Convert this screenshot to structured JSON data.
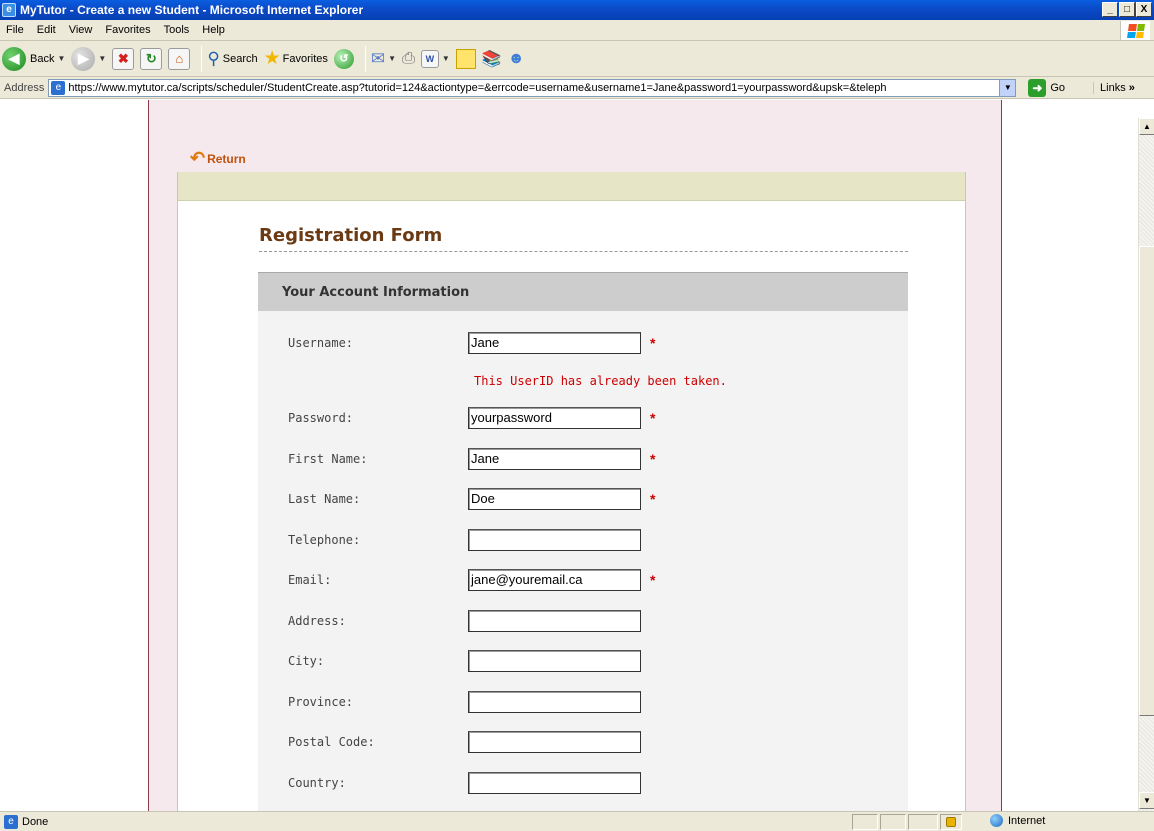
{
  "window": {
    "title": "MyTutor - Create a new Student - Microsoft Internet Explorer",
    "minimize": "_",
    "maximize": "□",
    "close": "X"
  },
  "menu": [
    "File",
    "Edit",
    "View",
    "Favorites",
    "Tools",
    "Help"
  ],
  "toolbar": {
    "back_label": "Back",
    "search_label": "Search",
    "favorites_label": "Favorites"
  },
  "address": {
    "label": "Address",
    "url": "https://www.mytutor.ca/scripts/scheduler/StudentCreate.asp?tutorid=124&actiontype=&errcode=username&username1=Jane&password1=yourpassword&upsk=&teleph",
    "go_label": "Go",
    "links_label": "Links"
  },
  "page": {
    "return_label": "Return",
    "form_title": "Registration Form",
    "section_title": "Your Account Information",
    "error_message": "This UserID has already been taken.",
    "fields": [
      {
        "label": "Username:",
        "value": "Jane",
        "required": "*"
      },
      {
        "label": "Password:",
        "value": "yourpassword",
        "required": "*"
      },
      {
        "label": "First Name:",
        "value": "Jane",
        "required": "*"
      },
      {
        "label": "Last Name:",
        "value": "Doe",
        "required": "*"
      },
      {
        "label": "Telephone:",
        "value": "",
        "required": ""
      },
      {
        "label": "Email:",
        "value": "jane@youremail.ca",
        "required": "*"
      },
      {
        "label": "Address:",
        "value": "",
        "required": ""
      },
      {
        "label": "City:",
        "value": "",
        "required": ""
      },
      {
        "label": "Province:",
        "value": "",
        "required": ""
      },
      {
        "label": "Postal Code:",
        "value": "",
        "required": ""
      },
      {
        "label": "Country:",
        "value": "",
        "required": ""
      }
    ]
  },
  "status": {
    "text": "Done",
    "zone": "Internet"
  }
}
